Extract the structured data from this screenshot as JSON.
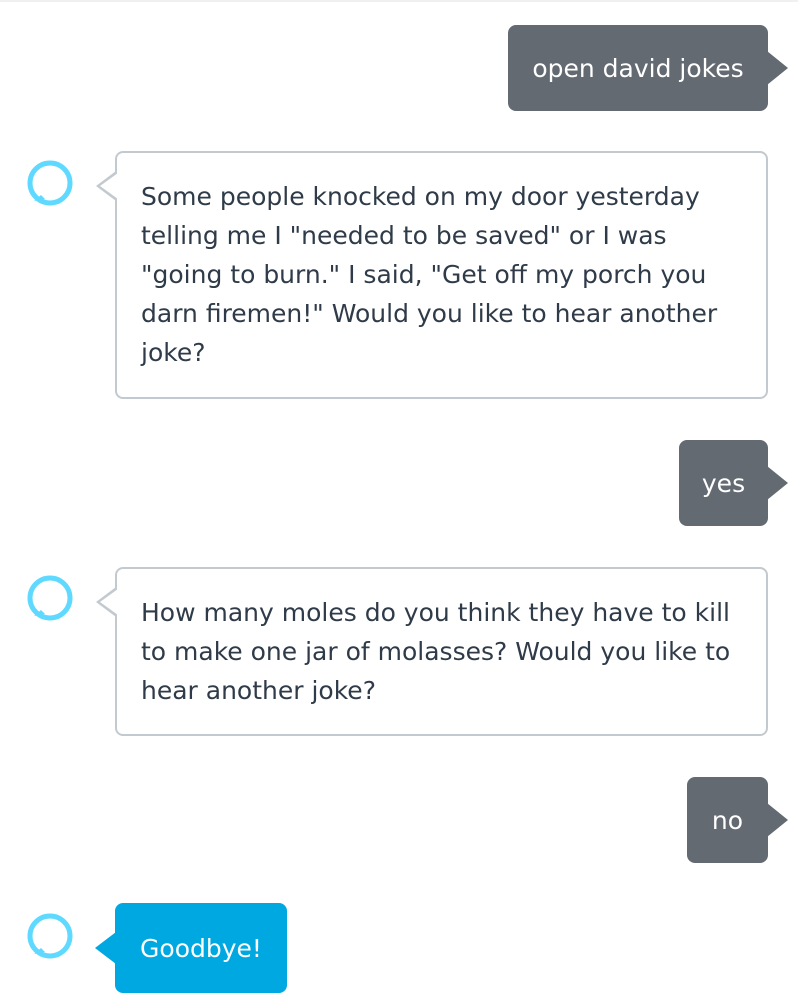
{
  "colors": {
    "user_bubble": "#646a72",
    "alexa_border": "#c3cacf",
    "alexa_text": "#2f3b48",
    "alexa_accent": "#00a8e1",
    "alexa_icon": "#5fd9ff"
  },
  "icons": {
    "alexa_avatar": "alexa-ring-icon"
  },
  "messages": [
    {
      "speaker": "user",
      "text": "open david jokes"
    },
    {
      "speaker": "alexa",
      "text": "Some people knocked on my door yesterday telling me I \"needed to be saved\" or I was \"going to burn.\" I said, \"Get off my porch you darn firemen!\" Would you like to hear another joke?"
    },
    {
      "speaker": "user",
      "text": "yes"
    },
    {
      "speaker": "alexa",
      "text": "How many moles do you think they have to kill to make one jar of molasses? Would you like to hear another joke?"
    },
    {
      "speaker": "user",
      "text": "no"
    },
    {
      "speaker": "alexa",
      "text": "Goodbye!"
    }
  ]
}
